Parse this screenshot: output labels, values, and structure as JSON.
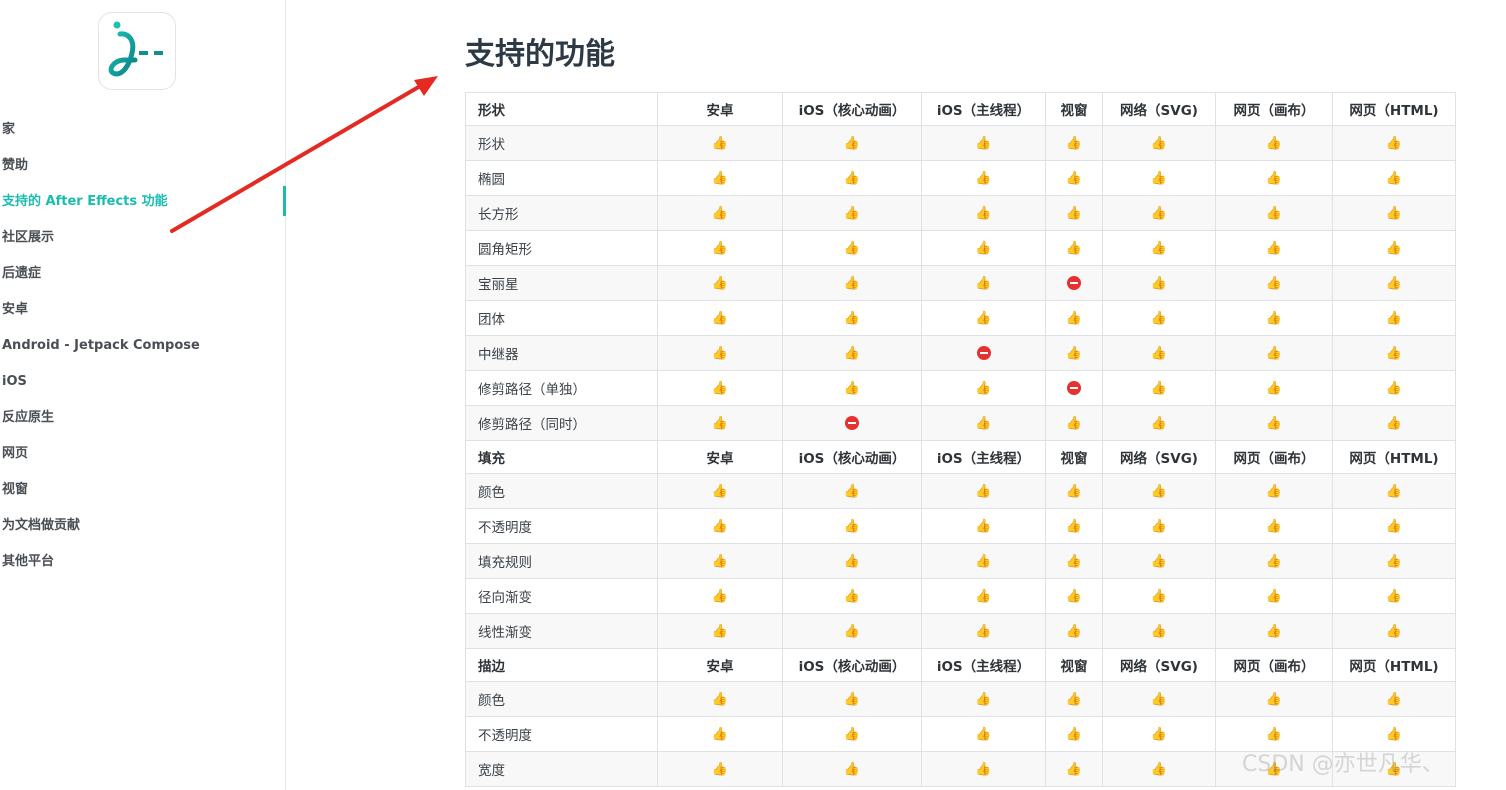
{
  "sidebar": {
    "items": [
      {
        "label": "家",
        "active": false
      },
      {
        "label": "赞助",
        "active": false
      },
      {
        "label": "支持的 After Effects 功能",
        "active": true
      },
      {
        "label": "社区展示",
        "active": false
      },
      {
        "label": "后遗症",
        "active": false
      },
      {
        "label": "安卓",
        "active": false
      },
      {
        "label": "Android - Jetpack Compose",
        "active": false
      },
      {
        "label": "iOS",
        "active": false
      },
      {
        "label": "反应原生",
        "active": false
      },
      {
        "label": "网页",
        "active": false
      },
      {
        "label": "视窗",
        "active": false
      },
      {
        "label": "为文档做贡献",
        "active": false
      },
      {
        "label": "其他平台",
        "active": false
      }
    ]
  },
  "colors": {
    "accent": "#1abcb0",
    "supported": "#f2b51d",
    "unsupported": "#e63131",
    "arrow": "#e52a22"
  },
  "icons": {
    "supported": "thumbs-up-icon",
    "unsupported": "no-entry-icon"
  },
  "main": {
    "title": "支持的功能",
    "columns": [
      "安卓",
      "iOS（核心动画）",
      "iOS（主线程）",
      "视窗",
      "网络（SVG)",
      "网页（画布）",
      "网页（HTML)"
    ],
    "sections": [
      {
        "header": "形状",
        "rows": [
          {
            "label": "形状",
            "cells": [
              "y",
              "y",
              "y",
              "y",
              "y",
              "y",
              "y"
            ]
          },
          {
            "label": "椭圆",
            "cells": [
              "y",
              "y",
              "y",
              "y",
              "y",
              "y",
              "y"
            ]
          },
          {
            "label": "长方形",
            "cells": [
              "y",
              "y",
              "y",
              "y",
              "y",
              "y",
              "y"
            ]
          },
          {
            "label": "圆角矩形",
            "cells": [
              "y",
              "y",
              "y",
              "y",
              "y",
              "y",
              "y"
            ]
          },
          {
            "label": "宝丽星",
            "cells": [
              "y",
              "y",
              "y",
              "n",
              "y",
              "y",
              "y"
            ]
          },
          {
            "label": "团体",
            "cells": [
              "y",
              "y",
              "y",
              "y",
              "y",
              "y",
              "y"
            ]
          },
          {
            "label": "中继器",
            "cells": [
              "y",
              "y",
              "n",
              "y",
              "y",
              "y",
              "y"
            ]
          },
          {
            "label": "修剪路径（单独）",
            "cells": [
              "y",
              "y",
              "y",
              "n",
              "y",
              "y",
              "y"
            ]
          },
          {
            "label": "修剪路径（同时）",
            "cells": [
              "y",
              "n",
              "y",
              "y",
              "y",
              "y",
              "y"
            ]
          }
        ]
      },
      {
        "header": "填充",
        "rows": [
          {
            "label": "颜色",
            "cells": [
              "y",
              "y",
              "y",
              "y",
              "y",
              "y",
              "y"
            ]
          },
          {
            "label": "不透明度",
            "cells": [
              "y",
              "y",
              "y",
              "y",
              "y",
              "y",
              "y"
            ]
          },
          {
            "label": "填充规则",
            "cells": [
              "y",
              "y",
              "y",
              "y",
              "y",
              "y",
              "y"
            ]
          },
          {
            "label": "径向渐变",
            "cells": [
              "y",
              "y",
              "y",
              "y",
              "y",
              "y",
              "y"
            ]
          },
          {
            "label": "线性渐变",
            "cells": [
              "y",
              "y",
              "y",
              "y",
              "y",
              "y",
              "y"
            ]
          }
        ]
      },
      {
        "header": "描边",
        "rows": [
          {
            "label": "颜色",
            "cells": [
              "y",
              "y",
              "y",
              "y",
              "y",
              "y",
              "y"
            ]
          },
          {
            "label": "不透明度",
            "cells": [
              "y",
              "y",
              "y",
              "y",
              "y",
              "y",
              "y"
            ]
          },
          {
            "label": "宽度",
            "cells": [
              "y",
              "y",
              "y",
              "y",
              "y",
              "y",
              "y"
            ]
          }
        ]
      }
    ]
  },
  "watermark": "CSDN @亦世凡华、"
}
